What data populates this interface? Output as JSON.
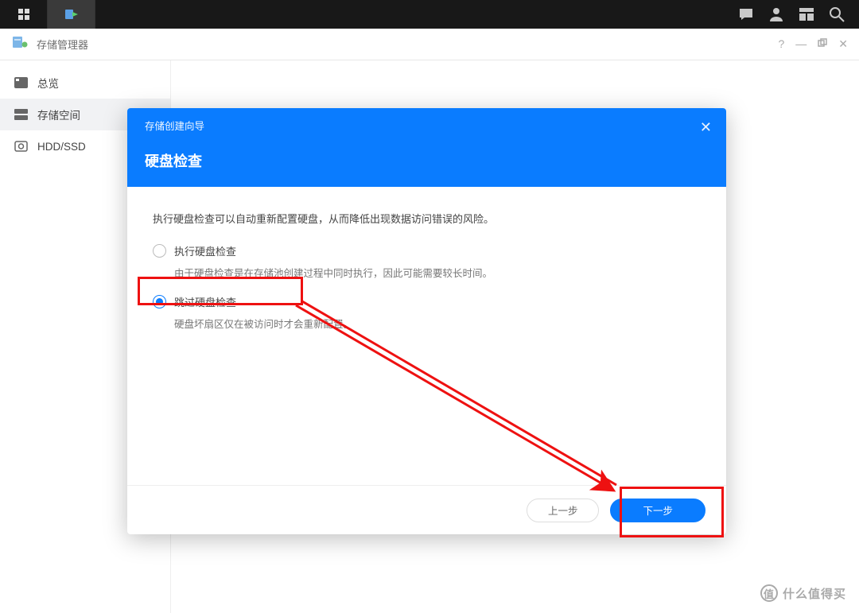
{
  "taskbar": {
    "icons_right": [
      "chat",
      "user",
      "widgets",
      "search"
    ]
  },
  "window": {
    "title": "存储管理器",
    "controls": [
      "help",
      "min",
      "max",
      "close"
    ]
  },
  "sidebar": {
    "items": [
      {
        "label": "总览",
        "icon": "overview",
        "active": false
      },
      {
        "label": "存储空间",
        "icon": "storage",
        "active": true
      },
      {
        "label": "HDD/SSD",
        "icon": "disk",
        "active": false
      }
    ]
  },
  "dialog": {
    "header_text": "存储创建向导",
    "title": "硬盘检查",
    "description": "执行硬盘检查可以自动重新配置硬盘，从而降低出现数据访问错误的风险。",
    "options": [
      {
        "label": "执行硬盘检查",
        "sub": "由于硬盘检查是在存储池创建过程中同时执行，因此可能需要较长时间。",
        "checked": false
      },
      {
        "label": "跳过硬盘检查",
        "sub": "硬盘坏扇区仅在被访问时才会重新配置。",
        "checked": true
      }
    ],
    "buttons": {
      "prev": "上一步",
      "next": "下一步"
    }
  },
  "watermark": "什么值得买"
}
